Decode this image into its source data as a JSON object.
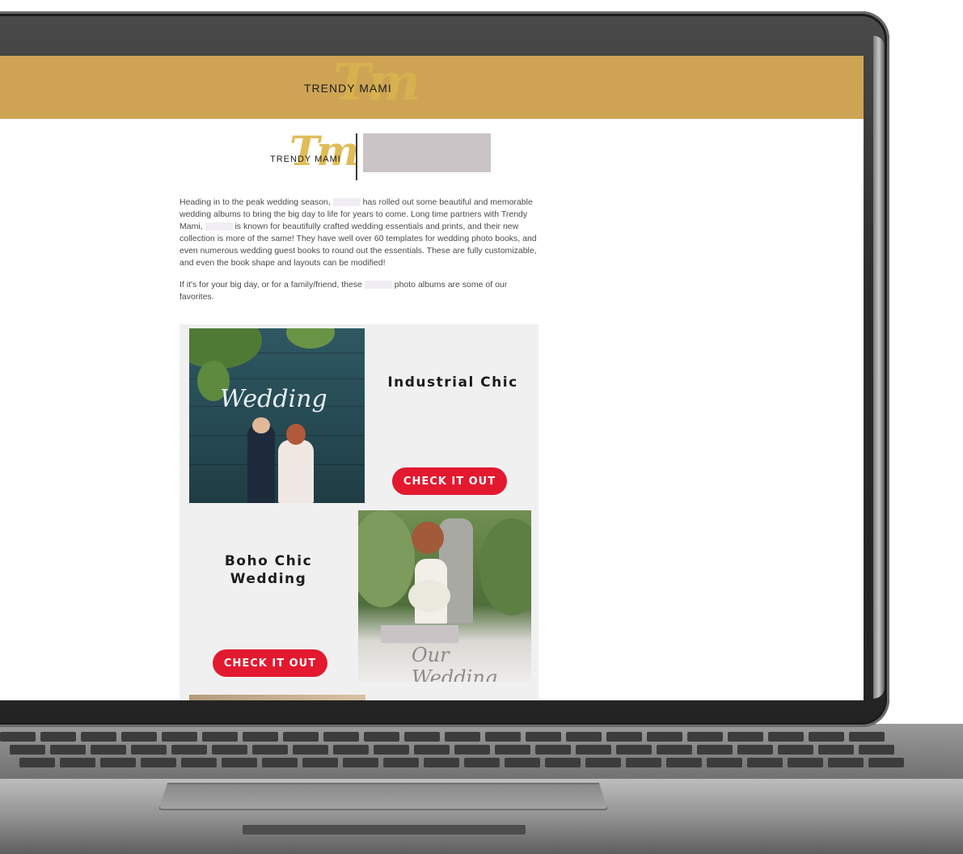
{
  "header": {
    "logo_monogram": "Tm",
    "brand_name": "TRENDY MAMI"
  },
  "subheader": {
    "logo_monogram": "Tm",
    "brand_name": "TRENDY MAMI"
  },
  "intro": {
    "paragraph1_a": "Heading in to the peak wedding season,",
    "paragraph1_b": "has rolled out some beautiful and memorable wedding albums to bring the big day to life for years to come. Long time partners with Trendy Mami,",
    "paragraph1_c": "is known for beautifully crafted wedding essentials and prints, and their new collection is more of the same! They have well over 60 templates for wedding photo books, and even numerous wedding guest books to round out the essentials. These are fully customizable, and even the book shape and layouts can be modified!",
    "paragraph2_a": "If it's for your big day, or for a family/friend, these",
    "paragraph2_b": "photo albums are some of our favorites."
  },
  "cards": [
    {
      "title": "Industrial Chic",
      "button_label": "CHECK IT OUT",
      "photo_caption": "Wedding"
    },
    {
      "title": "Boho Chic Wedding",
      "button_label": "CHECK IT OUT",
      "photo_caption": "Our Wedding"
    }
  ],
  "colors": {
    "header_gold": "#cea454",
    "cta_red": "#e3192f",
    "card_background": "#f1f0f0"
  }
}
